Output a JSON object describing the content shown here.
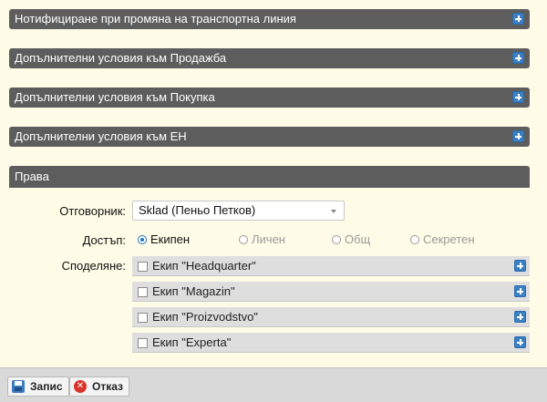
{
  "sections": [
    {
      "title": "Нотифициране при промяна на транспортна линия"
    },
    {
      "title": "Допълнителни условия към Продажба"
    },
    {
      "title": "Допълнителни условия към Покупка"
    },
    {
      "title": "Допълнителни условия към ЕН"
    }
  ],
  "rights": {
    "title": "Права",
    "responsible_label": "Отговорник:",
    "responsible_value": "Sklad (Пеньо Петков)",
    "access_label": "Достъп:",
    "access_options": [
      {
        "label": "Екипен",
        "selected": true
      },
      {
        "label": "Личен",
        "selected": false
      },
      {
        "label": "Общ",
        "selected": false
      },
      {
        "label": "Секретен",
        "selected": false
      }
    ],
    "sharing_label": "Споделяне:",
    "teams": [
      {
        "label": "Екип \"Headquarter\""
      },
      {
        "label": "Екип \"Magazin\""
      },
      {
        "label": "Екип \"Proizvodstvo\""
      },
      {
        "label": "Екип \"Experta\""
      }
    ]
  },
  "footer": {
    "save_label": "Запис",
    "cancel_label": "Отказ",
    "cancel_glyph": "✕"
  },
  "colors": {
    "background": "#fefbe6",
    "section_bar": "#5d5d5d",
    "accent": "#3a7fc4",
    "selected_radio": "#1e73c8",
    "cancel": "#d9342b"
  }
}
